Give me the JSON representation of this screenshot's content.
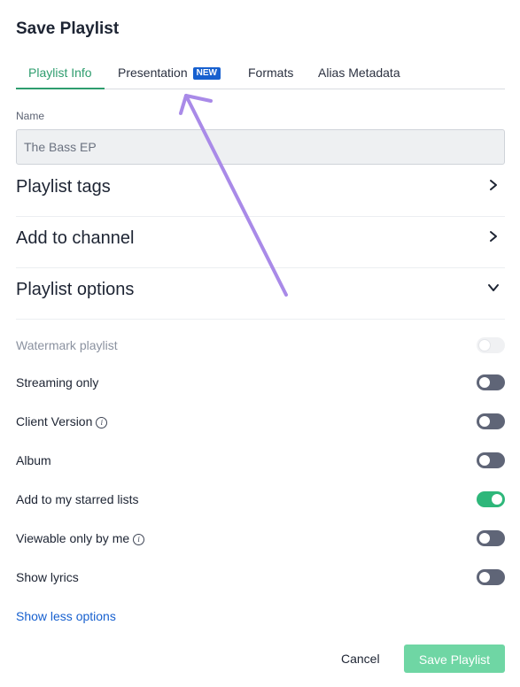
{
  "dialog": {
    "title": "Save Playlist"
  },
  "tabs": [
    {
      "label": "Playlist Info",
      "active": true
    },
    {
      "label": "Presentation",
      "badge": "NEW"
    },
    {
      "label": "Formats"
    },
    {
      "label": "Alias Metadata"
    }
  ],
  "name_field": {
    "label": "Name",
    "value": "The Bass EP",
    "placeholder": ""
  },
  "sections": {
    "tags": {
      "label": "Playlist tags",
      "icon": "chevron-right-icon"
    },
    "channel": {
      "label": "Add to channel",
      "icon": "chevron-right-icon"
    },
    "options": {
      "label": "Playlist options",
      "icon": "chevron-down-icon"
    }
  },
  "options": [
    {
      "label": "Watermark playlist",
      "state": "disabled"
    },
    {
      "label": "Streaming only",
      "state": "off"
    },
    {
      "label": "Client Version",
      "state": "off",
      "info": true
    },
    {
      "label": "Album",
      "state": "off"
    },
    {
      "label": "Add to my starred lists",
      "state": "on"
    },
    {
      "label": "Viewable only by me",
      "state": "off",
      "info": true
    },
    {
      "label": "Show lyrics",
      "state": "off"
    }
  ],
  "show_less_link": "Show less options",
  "footer": {
    "cancel_label": "Cancel",
    "save_label": "Save Playlist"
  },
  "colors": {
    "accent_green": "#2e9d6e",
    "toggle_on": "#2eb77a",
    "toggle_off": "#5f6577",
    "link_blue": "#1760cf",
    "save_button": "#6fd6a4",
    "annotation_arrow": "#a98ae8"
  }
}
